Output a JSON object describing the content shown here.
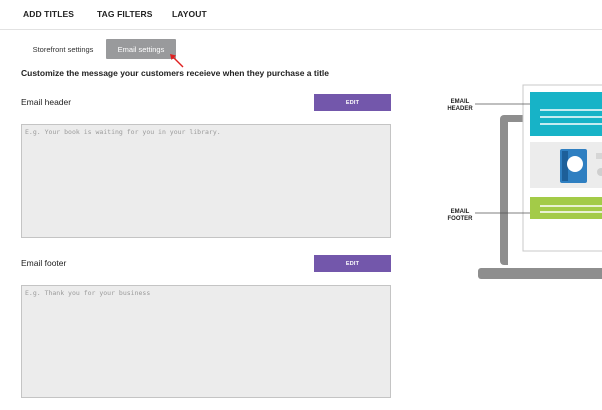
{
  "topnav": {
    "items": [
      {
        "label": "ADD TITLES"
      },
      {
        "label": "TAG FILTERS"
      },
      {
        "label": "LAYOUT"
      }
    ]
  },
  "subtabs": {
    "storefront": "Storefront settings",
    "email": "Email settings"
  },
  "heading": "Customize the message your customers receieve when they purchase a title",
  "header_section": {
    "label": "Email header",
    "edit_label": "EDIT",
    "placeholder": "E.g. Your book is waiting for you in your library."
  },
  "footer_section": {
    "label": "Email footer",
    "edit_label": "EDIT",
    "placeholder": "E.g. Thank you for your business"
  },
  "illustration": {
    "header_label_line1": "EMAIL",
    "header_label_line2": "HEADER",
    "footer_label_line1": "EMAIL",
    "footer_label_line2": "FOOTER",
    "colors": {
      "header_bar": "#17b3c7",
      "footer_bar": "#a3cb48",
      "book": "#2f7fc1",
      "device": "#8e8e8e"
    }
  },
  "colors": {
    "edit_button": "#7357ab",
    "active_tab": "#999a9c",
    "arrow": "#e02020"
  }
}
